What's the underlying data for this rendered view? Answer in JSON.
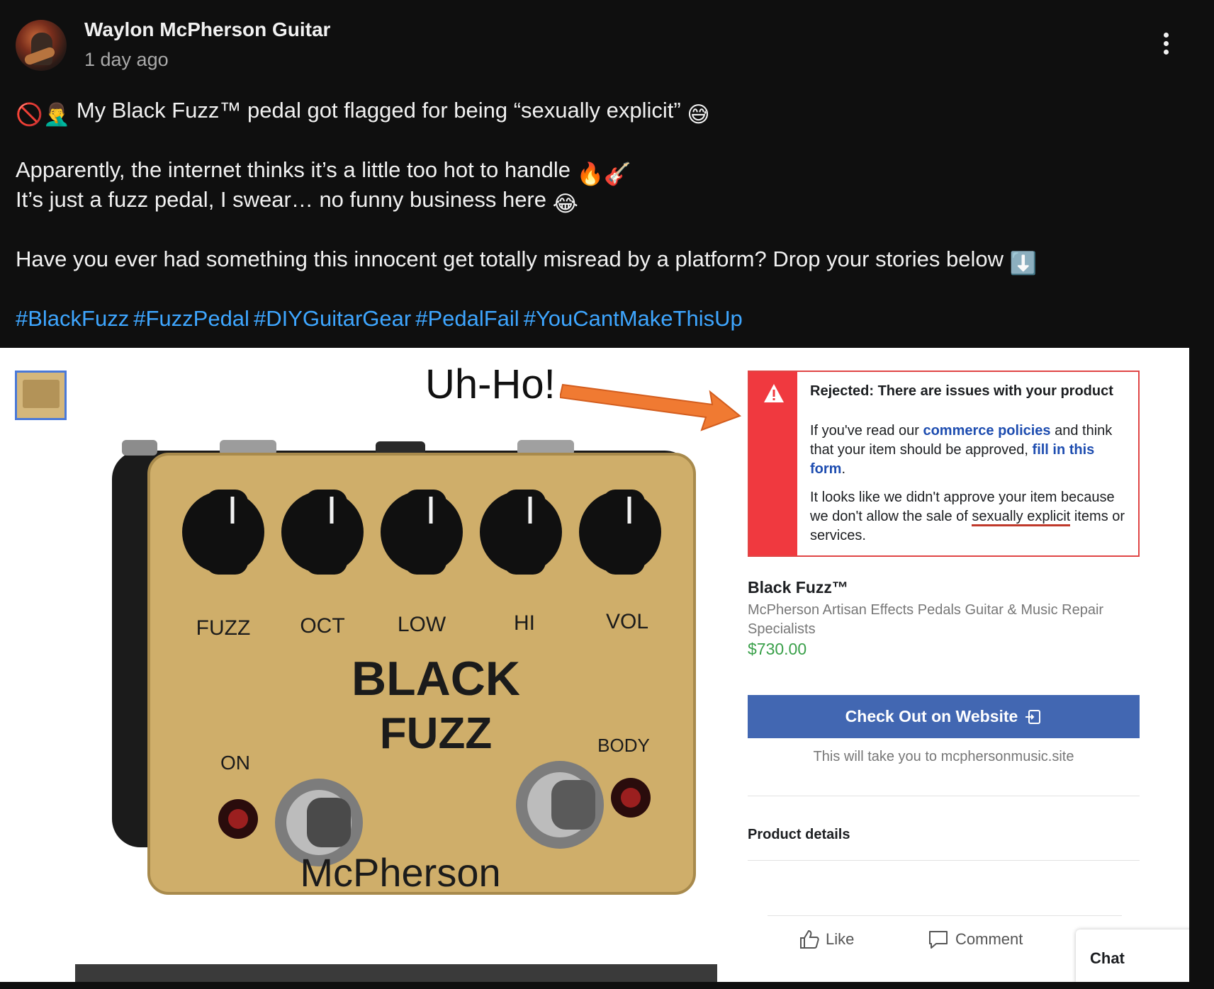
{
  "post": {
    "author": "Waylon McPherson Guitar",
    "time": "1 day ago",
    "line1": "My Black Fuzz™ pedal got flagged for being “sexually explicit”",
    "line2": "Apparently, the internet thinks it’s a little too hot to handle",
    "line3": "It’s just a fuzz pedal, I swear… no funny business here",
    "line4": "Have you ever had something this innocent get totally misread by a platform? Drop your stories below",
    "hashtags": [
      "#BlackFuzz",
      "#FuzzPedal",
      "#DIYGuitarGear",
      "#PedalFail",
      "#YouCantMakeThisUp"
    ],
    "emoji_prohibited": "🚫",
    "emoji_facepalm": "🤦‍♂️",
    "emoji_sweat": "😅",
    "emoji_fire": "🔥",
    "emoji_guitar": "🎸",
    "emoji_joy": "😂",
    "emoji_down": "⬇️"
  },
  "image": {
    "caption": "Uh-Ho!",
    "pedal": {
      "knobs": [
        "FUZZ",
        "OCT",
        "LOW",
        "HI",
        "VOL"
      ],
      "brand_line1": "BLACK",
      "brand_line2": "FUZZ",
      "on_label": "ON",
      "body_label": "BODY",
      "maker": "McPherson"
    },
    "rejection": {
      "title": "Rejected: There are issues with your product",
      "p1_start": "If you've read our ",
      "p1_link1": "commerce policies",
      "p1_mid": " and think that your item should be approved, ",
      "p1_link2": "fill in this form",
      "p1_end": ".",
      "p2_start": "It looks like we didn't approve your item because we don't allow the sale of ",
      "p2_underlined": "sexually explicit",
      "p2_end": " items or services."
    },
    "product": {
      "name": "Black Fuzz™",
      "seller": "McPherson Artisan Effects Pedals Guitar & Music Repair Specialists",
      "price": "$730.00",
      "checkout_label": "Check Out on Website",
      "redirect_note": "This will take you to mcphersonmusic.site",
      "details_label": "Product details"
    },
    "actions": {
      "like": "Like",
      "comment": "Comment",
      "chat": "Chat"
    }
  },
  "colors": {
    "background": "#0f0f0f",
    "hashtag": "#3ea6ff",
    "reject_red": "#f0393f",
    "checkout_blue": "#4267b2",
    "price_green": "#3aa04a"
  }
}
